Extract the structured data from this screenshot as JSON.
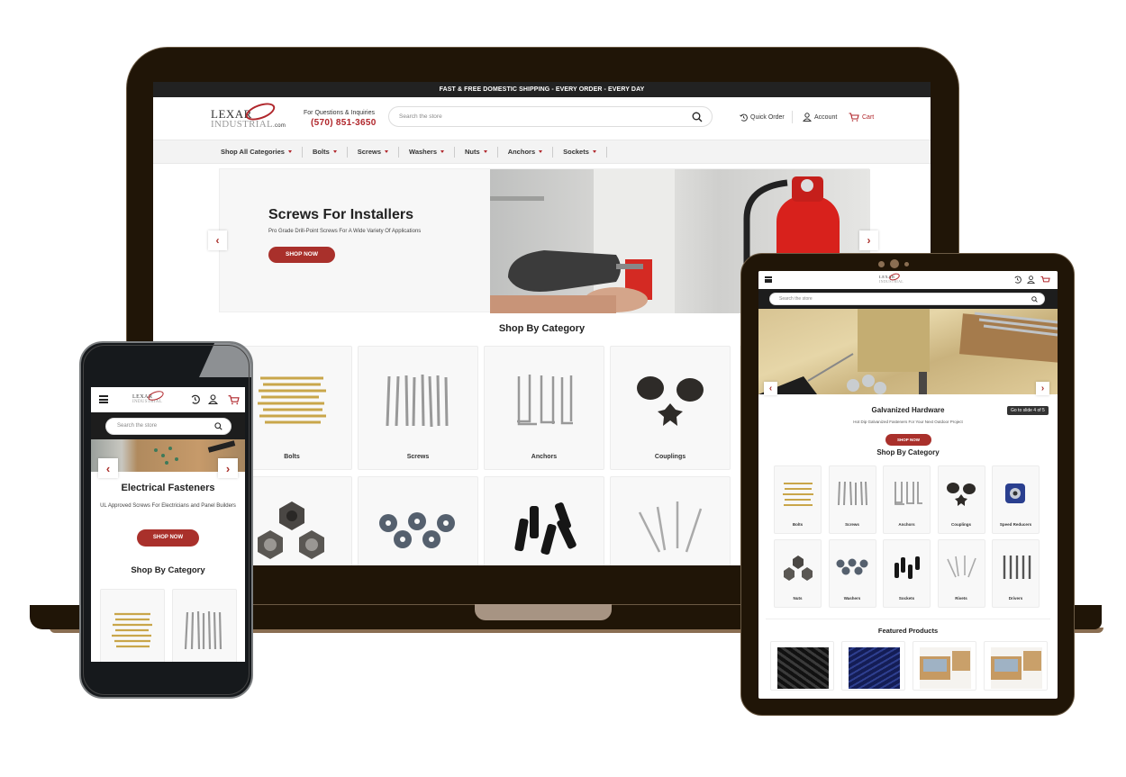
{
  "desktop": {
    "announcement": "FAST & FREE DOMESTIC SHIPPING - EVERY ORDER - EVERY DAY",
    "logo": {
      "line1": "LEXAR",
      "line2": "INDUSTRIAL",
      "suffix": ".com"
    },
    "contact": {
      "label": "For Questions & Inquiries",
      "phone": "(570) 851-3650"
    },
    "search_placeholder": "Search the store",
    "header_links": [
      {
        "label": "Quick Order",
        "icon": "history-icon"
      },
      {
        "label": "Account",
        "icon": "user-icon"
      },
      {
        "label": "Cart",
        "icon": "cart-icon"
      }
    ],
    "nav": [
      "Shop All Categories",
      "Bolts",
      "Screws",
      "Washers",
      "Nuts",
      "Anchors",
      "Sockets"
    ],
    "hero": {
      "title": "Screws For Installers",
      "subtitle": "Pro Grade Drill-Point Screws For A Wide Variety Of Applications",
      "cta": "SHOP NOW"
    },
    "section_title": "Shop By Category",
    "categories": [
      "Bolts",
      "Screws",
      "Anchors",
      "Couplings",
      "Nuts",
      "Washers",
      "Sockets",
      "Rivets"
    ]
  },
  "tablet": {
    "search_placeholder": "Search the store",
    "hero": {
      "title": "Galvanized Hardware",
      "subtitle": "Hot Dip Galvanized Fasteners For Your Next Outdoor Project",
      "cta": "SHOP NOW",
      "slide_tooltip": "Go to slide 4 of 5"
    },
    "section_title": "Shop By Category",
    "categories": [
      "Bolts",
      "Screws",
      "Anchors",
      "Couplings",
      "Speed Reducers",
      "Nuts",
      "Washers",
      "Sockets",
      "Rivets",
      "Drivers"
    ],
    "featured_title": "Featured Products"
  },
  "mobile": {
    "search_placeholder": "Search the store",
    "hero": {
      "title": "Electrical Fasteners",
      "subtitle": "UL Approved Screws For Electricians and Panel Builders",
      "cta": "SHOP NOW"
    },
    "section_title": "Shop By Category"
  },
  "colors": {
    "brand_red": "#a9302b",
    "dark_bar": "#222222",
    "device_frame": "#201507"
  }
}
